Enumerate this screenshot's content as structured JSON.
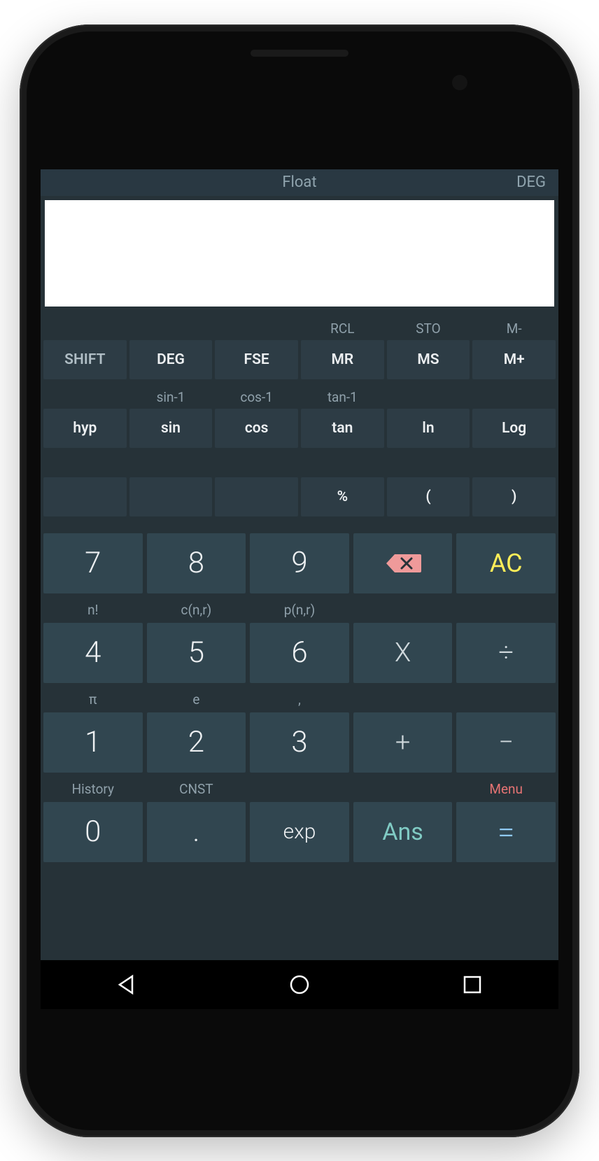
{
  "status": {
    "mode": "Float",
    "angle": "DEG"
  },
  "display": {
    "value": ""
  },
  "row1_secondary": [
    "",
    "",
    "",
    "RCL",
    "STO",
    "M-"
  ],
  "row1": [
    "SHIFT",
    "DEG",
    "FSE",
    "MR",
    "MS",
    "M+"
  ],
  "row2_secondary": [
    "",
    "sin-1",
    "cos-1",
    "tan-1",
    "",
    ""
  ],
  "row2": [
    "hyp",
    "sin",
    "cos",
    "tan",
    "ln",
    "Log"
  ],
  "row3_secondary": [
    "",
    "",
    "",
    "",
    "",
    ""
  ],
  "row3": [
    "",
    "",
    "",
    "%",
    "(",
    ")"
  ],
  "kp": {
    "r1": [
      "7",
      "8",
      "9",
      "⌫",
      "AC"
    ],
    "r2_labels": [
      "n!",
      "c(n,r)",
      "p(n,r)",
      "",
      ""
    ],
    "r2": [
      "4",
      "5",
      "6",
      "X",
      "÷"
    ],
    "r3_labels": [
      "π",
      "e",
      ",",
      "",
      ""
    ],
    "r3": [
      "1",
      "2",
      "3",
      "+",
      "−"
    ],
    "r4_labels": [
      "History",
      "CNST",
      "",
      "",
      "Menu"
    ],
    "r4": [
      "0",
      ".",
      "exp",
      "Ans",
      "="
    ]
  }
}
